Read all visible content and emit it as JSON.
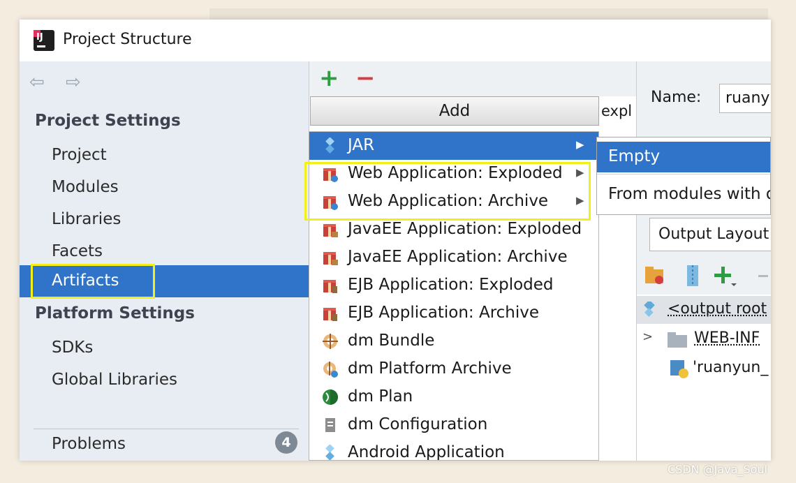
{
  "window": {
    "title": "Project Structure"
  },
  "sidebar": {
    "project_settings_heading": "Project Settings",
    "items": [
      "Project",
      "Modules",
      "Libraries",
      "Facets",
      "Artifacts"
    ],
    "selected": "Artifacts",
    "platform_settings_heading": "Platform Settings",
    "platform_items": [
      "SDKs",
      "Global Libraries"
    ],
    "problems_label": "Problems",
    "problems_count": "4"
  },
  "toolbar": {
    "add_icon": "+",
    "remove_icon": "−"
  },
  "add_menu": {
    "header": "Add",
    "partial_text": "expl",
    "items": [
      {
        "label": "JAR",
        "icon": "jar-icon",
        "has_submenu": true,
        "selected": true
      },
      {
        "label": "Web Application: Exploded",
        "icon": "web-app-icon",
        "has_submenu": true
      },
      {
        "label": "Web Application: Archive",
        "icon": "web-app-icon",
        "has_submenu": true
      },
      {
        "label": "JavaEE Application: Exploded",
        "icon": "javaee-icon",
        "has_submenu": false
      },
      {
        "label": "JavaEE Application: Archive",
        "icon": "javaee-icon",
        "has_submenu": false
      },
      {
        "label": "EJB Application: Exploded",
        "icon": "ejb-icon",
        "has_submenu": false
      },
      {
        "label": "EJB Application: Archive",
        "icon": "ejb-icon",
        "has_submenu": false
      },
      {
        "label": "dm Bundle",
        "icon": "bundle-icon",
        "has_submenu": false
      },
      {
        "label": "dm Platform Archive",
        "icon": "platform-archive-icon",
        "has_submenu": false
      },
      {
        "label": "dm Plan",
        "icon": "plan-icon",
        "has_submenu": false
      },
      {
        "label": "dm Configuration",
        "icon": "configuration-icon",
        "has_submenu": false
      },
      {
        "label": "Android Application",
        "icon": "android-icon",
        "has_submenu": false
      }
    ]
  },
  "submenu": {
    "items": [
      "Empty",
      "From modules with d"
    ],
    "selected": "Empty"
  },
  "right_panel": {
    "name_label": "Name:",
    "name_value": "ruanyu",
    "tab_label": "Output Layout",
    "tree": [
      "<output root",
      "WEB-INF",
      "'ruanyun_"
    ]
  },
  "watermark": "CSDN @Java_Soul",
  "colors": {
    "selection": "#2f74c9",
    "highlight": "#f2ef1a",
    "add": "#2e9d42",
    "remove": "#d63d3d"
  }
}
